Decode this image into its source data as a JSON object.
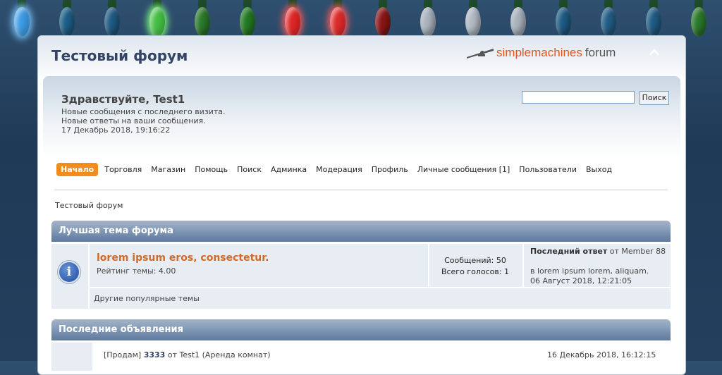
{
  "header": {
    "forum_title": "Тестовый форум",
    "logo_text_1": "simplemachines",
    "logo_text_2": "forum"
  },
  "user_panel": {
    "greeting": "Здравствуйте, Test1",
    "new_posts": "Новые сообщения с последнего визита.",
    "new_replies": "Новые ответы на ваши сообщения.",
    "datetime": "17 Декабрь 2018, 19:16:22",
    "search_value": "",
    "search_button": "Поиск"
  },
  "menu": {
    "items": [
      "Начало",
      "Торговля",
      "Магазин",
      "Помощь",
      "Поиск",
      "Админка",
      "Модерация",
      "Профиль",
      "Личные сообщения [1]",
      "Пользователи",
      "Выход"
    ],
    "active_index": 0
  },
  "breadcrumb": "Тестовый форум",
  "best_topic": {
    "category_title": "Лучшая тема форума",
    "topic_title": "lorem ipsum eros, consectetur.",
    "rating": "Рейтинг темы: 4.00",
    "posts": "Сообщений: 50",
    "votes": "Всего голосов: 1",
    "last_post_label": "Последний ответ",
    "last_post_from": "от Member 88",
    "last_post_in": "в lorem ipsum lorem, aliquam.",
    "last_post_date": "06 Август 2018, 12:21:05",
    "popular_link": "Другие популярные темы"
  },
  "announcements": {
    "category_title": "Последние объявления",
    "item_prefix": "[Продам]",
    "item_title": "3333",
    "item_author": "от Test1 (Аренда комнат)",
    "item_date": "16 Декабрь 2018, 16:12:15"
  },
  "colors": {
    "accent_orange": "#f28c1a",
    "title_blue": "#334466",
    "topic_link": "#d26a2a"
  },
  "lights": [
    "blue-glow",
    "blue",
    "blue",
    "green-glow",
    "green",
    "green",
    "red-glow",
    "red-glow",
    "darkred",
    "silver",
    "silver",
    "silver",
    "blue",
    "blue",
    "blue",
    "green"
  ]
}
